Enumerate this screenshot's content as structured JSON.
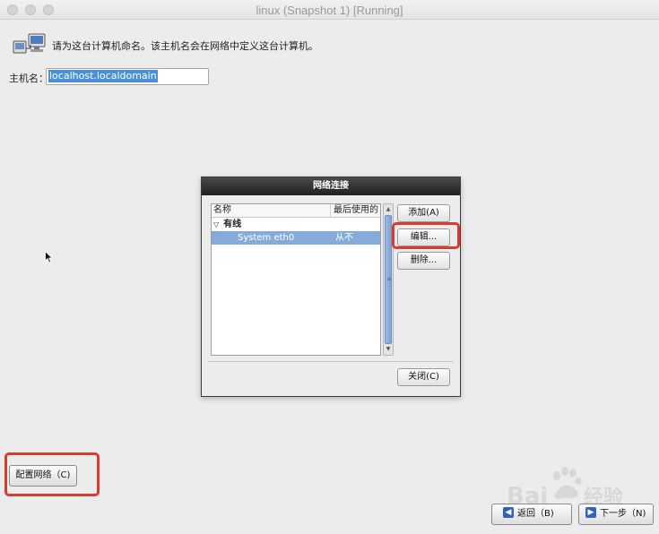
{
  "window": {
    "title": "linux (Snapshot 1) [Running]"
  },
  "page": {
    "intro_text": "请为这台计算机命名。该主机名会在网络中定义这台计算机。",
    "hostname_label": "主机名：",
    "hostname_value": "localhost.localdomain"
  },
  "dialog": {
    "title": "网络连接",
    "columns": [
      "名称",
      "最后使用的"
    ],
    "group_label": "有线",
    "connection": {
      "name": "System eth0",
      "last_used": "从不"
    },
    "add_label": "添加(A)",
    "edit_label": "编辑...",
    "delete_label": "删除...",
    "close_label": "关闭(C)"
  },
  "footer": {
    "configure_network_label": "配置网络（C)",
    "back_label": "返回（B)",
    "next_label": "下一步（N)"
  },
  "colors": {
    "highlight": "#d93b2f",
    "selection": "#86abd9",
    "dialog_title_bar": "#2a2a2a"
  }
}
